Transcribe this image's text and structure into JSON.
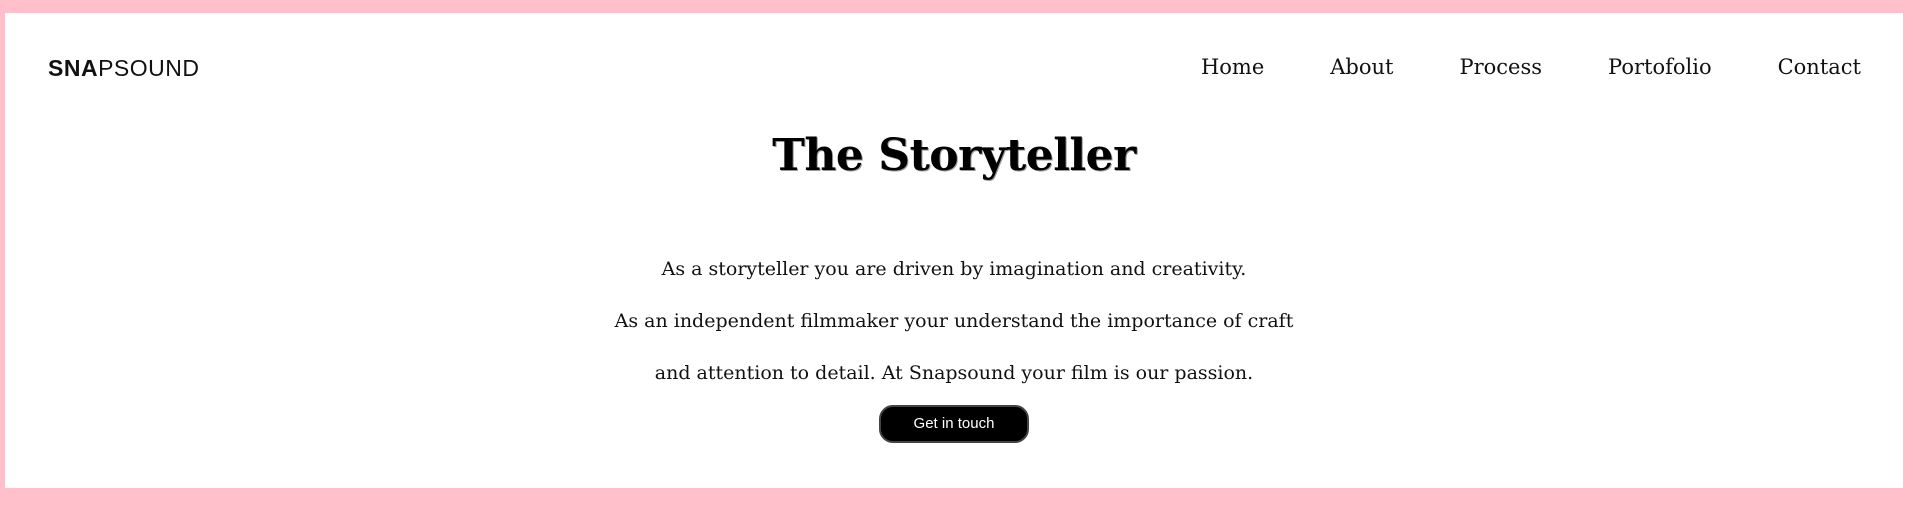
{
  "brand": {
    "bold": "SNA",
    "light": "PSOUND"
  },
  "nav": {
    "items": [
      {
        "label": "Home"
      },
      {
        "label": "About"
      },
      {
        "label": "Process"
      },
      {
        "label": "Portofolio"
      },
      {
        "label": "Contact"
      }
    ]
  },
  "hero": {
    "title": "The Storyteller",
    "lines": [
      "As a storyteller you are driven by imagination and creativity.",
      "As an independent filmmaker your understand the importance of craft",
      "and attention to detail. At Snapsound your film is our passion."
    ],
    "cta_label": "Get in touch"
  },
  "colors": {
    "page_border": "#FFC0CB",
    "background": "#FFFFFF",
    "text": "#111111",
    "button": "#000000",
    "button_text": "#FFFFFF"
  }
}
